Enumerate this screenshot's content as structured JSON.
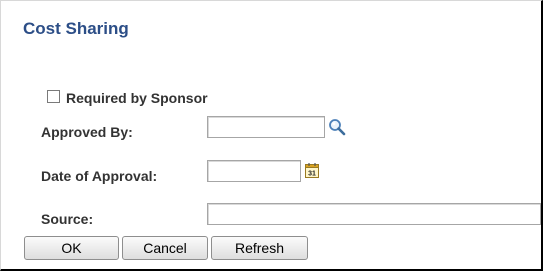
{
  "dialog": {
    "title": "Cost Sharing"
  },
  "form": {
    "required_by_sponsor": {
      "label": "Required by Sponsor",
      "checked": false
    },
    "approved_by": {
      "label": "Approved By:",
      "value": "",
      "icon": "lookup-magnifier-icon"
    },
    "date_of_approval": {
      "label": "Date of Approval:",
      "value": "",
      "icon": "calendar-icon",
      "icon_text": "31"
    },
    "source": {
      "label": "Source:",
      "value": ""
    }
  },
  "buttons": {
    "ok": "OK",
    "cancel": "Cancel",
    "refresh": "Refresh"
  },
  "colors": {
    "title": "#2c4e87",
    "label": "#333333"
  }
}
